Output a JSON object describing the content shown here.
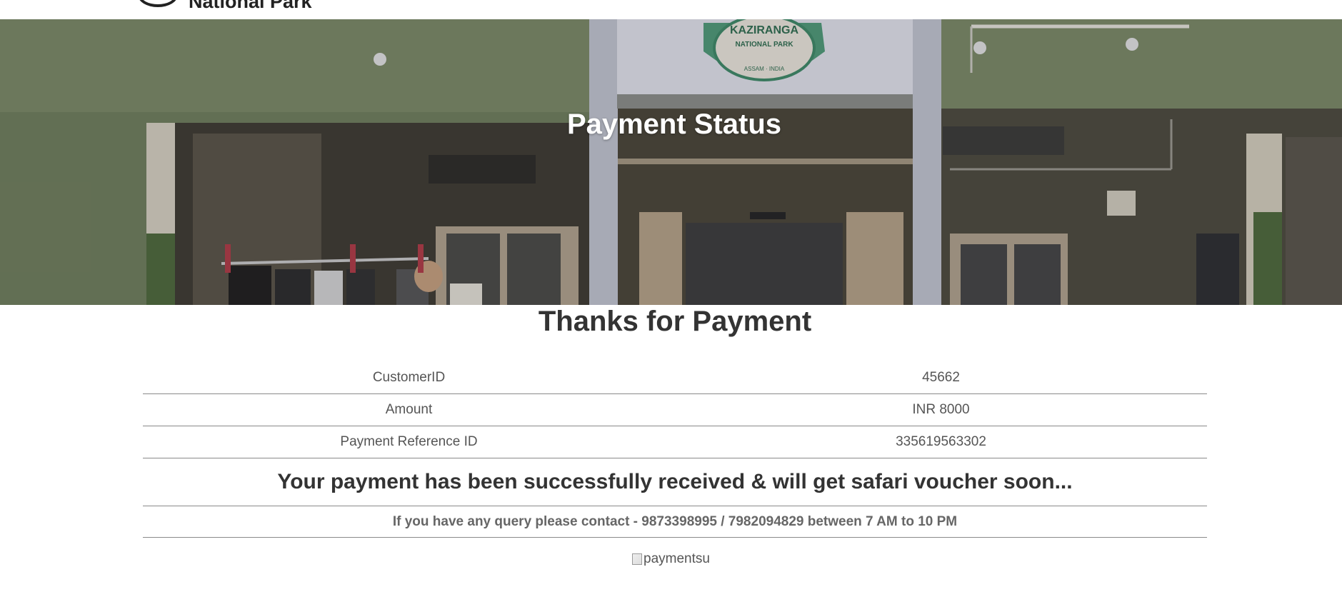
{
  "header": {
    "logo_text": "National Park"
  },
  "hero": {
    "title": "Payment Status",
    "sign_text_top": "KAZIRANGA",
    "sign_text_mid": "NATIONAL PARK",
    "sign_text_bottom": "ASSAM · INDIA"
  },
  "main": {
    "heading": "Thanks for Payment",
    "rows": [
      {
        "label": "CustomerID",
        "value": "45662"
      },
      {
        "label": "Amount",
        "value": "INR 8000"
      },
      {
        "label": "Payment Reference ID",
        "value": "335619563302"
      }
    ],
    "success_message": "Your payment has been successfully received & will get safari voucher soon...",
    "contact_message": "If you have any query please contact - 9873398995 / 7982094829 between 7 AM to 10 PM",
    "image_alt": "paymentsu"
  },
  "colors": {
    "text_dark": "#333333",
    "text_muted": "#555555",
    "divider": "#8a8a8a",
    "hero_title": "#ffffff"
  }
}
